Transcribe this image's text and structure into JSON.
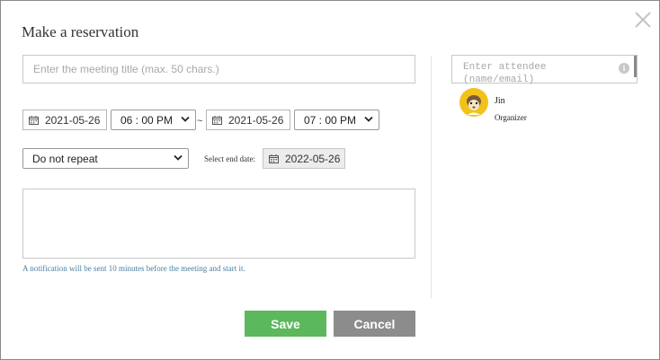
{
  "dialog": {
    "title": "Make a reservation"
  },
  "form": {
    "title_placeholder": "Enter the meeting title (max. 50 chars.)",
    "start_date": "2021-05-26",
    "start_time": "06 : 00 PM",
    "separator": "~",
    "end_date": "2021-05-26",
    "end_time": "07 : 00 PM",
    "repeat": "Do not repeat",
    "end_date_label": "Select end date:",
    "repeat_end_date": "2022-05-26",
    "memo_value": "",
    "notice": "A notification will be sent 10 minutes before the meeting and start it."
  },
  "attendees": {
    "placeholder": "Enter attendee (name/email)",
    "info_glyph": "i",
    "list": [
      {
        "name": "Jin",
        "role": "Organizer"
      }
    ]
  },
  "buttons": {
    "save": "Save",
    "cancel": "Cancel"
  },
  "colors": {
    "save_button": "#5cb85c",
    "cancel_button": "#8c8c8c",
    "notice_text": "#4a7f9e",
    "avatar_bg": "#f2c21b"
  },
  "icons": {
    "close": "close-icon",
    "calendar": "calendar-icon",
    "chevron": "chevron-down-icon",
    "info": "info-icon"
  }
}
